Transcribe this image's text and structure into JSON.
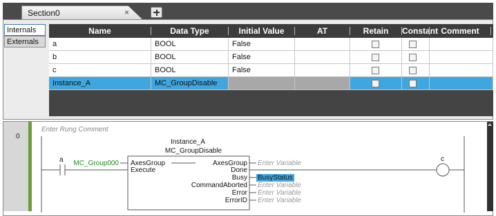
{
  "section_tab": {
    "label": "Section0",
    "close": "×"
  },
  "side_tabs": [
    "Internals",
    "Externals"
  ],
  "table": {
    "headers": [
      "Name",
      "Data Type",
      "Initial Value",
      "AT",
      "Retain",
      "Constant",
      "Comment"
    ],
    "rows": [
      {
        "name": "a",
        "type": "BOOL",
        "initial": "False",
        "at": "",
        "retain": false,
        "constant": false,
        "comment": ""
      },
      {
        "name": "b",
        "type": "BOOL",
        "initial": "False",
        "at": "",
        "retain": false,
        "constant": false,
        "comment": ""
      },
      {
        "name": "c",
        "type": "BOOL",
        "initial": "False",
        "at": "",
        "retain": false,
        "constant": false,
        "comment": ""
      },
      {
        "name": "Instance_A",
        "type": "MC_GroupDisable",
        "initial": "",
        "at": "",
        "retain": false,
        "constant": false,
        "comment": "",
        "selected": true
      }
    ]
  },
  "ladder": {
    "rung_number": "0",
    "comment_placeholder": "Enter Rung Comment",
    "contact_label": "a",
    "fb_instance": "Instance_A",
    "fb_type": "MC_GroupDisable",
    "input_variable": "MC_Group000",
    "inputs": [
      "AxesGroup",
      "Execute"
    ],
    "outputs": [
      "AxesGroup",
      "Done",
      "Busy",
      "CommandAborted",
      "Error",
      "ErrorID"
    ],
    "output_vars": [
      "Enter Variable",
      "",
      "BusyStatus",
      "Enter Variable",
      "Enter Variable",
      "Enter Variable"
    ],
    "coil_label": "c"
  },
  "colors": {
    "selection": "#3fa6df",
    "rung_bar": "#6b9e3b",
    "variable": "#1e8a1e"
  }
}
